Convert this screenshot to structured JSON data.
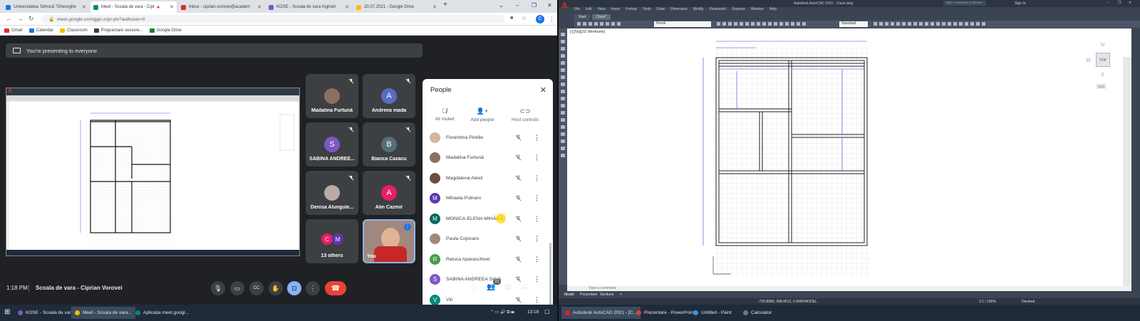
{
  "browser": {
    "tabs": [
      {
        "title": "Universitatea Tehnică \"Gheorghe",
        "fav": "#1a73e8"
      },
      {
        "title": "Meet - Scoala de vara - Cipr",
        "fav": "#00897b"
      },
      {
        "title": "Inbox - ciprian.vorovei@academ",
        "fav": "#d93025"
      },
      {
        "title": "KOSE - Scoala de vara Ingineri",
        "fav": "#7e57c2"
      },
      {
        "title": "20.07.2021 - Google Drive",
        "fav": "#fbbc04"
      }
    ],
    "url": "meet.google.com/ggo-zojn-ytv?authuser=0",
    "profile_initial": "C",
    "bookmarks": [
      {
        "label": "Gmail",
        "color": "#d93025"
      },
      {
        "label": "Calendar",
        "color": "#1a73e8"
      },
      {
        "label": "Classroom",
        "color": "#fbbc04"
      },
      {
        "label": "Programare sesiune...",
        "color": "#3c4043"
      },
      {
        "label": "Google Drive",
        "color": "#188038"
      }
    ]
  },
  "meet": {
    "presenting_banner": "You're presenting to everyone",
    "tiles": [
      {
        "name": "Madalina Furtună",
        "initial": "",
        "color": "#8d6e63",
        "photo": true
      },
      {
        "name": "Andreea mada",
        "initial": "A",
        "color": "#5c6bc0"
      },
      {
        "name": "SABINA ANDREE...",
        "initial": "S",
        "color": "#7e57c2"
      },
      {
        "name": "Bianca Cazacu",
        "initial": "B",
        "color": "#546e7a"
      },
      {
        "name": "Denisa Alungule...",
        "initial": "",
        "color": "#bcaaa4",
        "photo": true
      },
      {
        "name": "Alin Cazmir",
        "initial": "A",
        "color": "#e91e63"
      },
      {
        "name": "13 others",
        "initial": "C",
        "initial2": "M",
        "color": "#e91e63",
        "color2": "#5e35b1"
      },
      {
        "name": "You",
        "initial": "",
        "color": "#c62828",
        "photo": true
      }
    ],
    "people_panel": {
      "title": "People",
      "actions": [
        {
          "label": "All muted",
          "icon": "mic-off-icon"
        },
        {
          "label": "Add people",
          "icon": "add-person-icon"
        },
        {
          "label": "Host controls",
          "icon": "host-controls-icon"
        }
      ],
      "participants": [
        {
          "name": "Florentina Pintilie",
          "initial": "",
          "color": "#d7b49e"
        },
        {
          "name": "Madalina Furtună",
          "initial": "",
          "color": "#8d6e63"
        },
        {
          "name": "Magdalena Alexii",
          "initial": "",
          "color": "#6d4c41"
        },
        {
          "name": "Mihaela Putnaru",
          "initial": "M",
          "color": "#5e35b1"
        },
        {
          "name": "MONICA-ELENA MIHĂILĂ",
          "initial": "M",
          "color": "#00695c"
        },
        {
          "name": "Paula Cojocaru",
          "initial": "",
          "color": "#a1887f"
        },
        {
          "name": "Raluca Aparaschivei",
          "initial": "R",
          "color": "#43a047"
        },
        {
          "name": "SABINA ANDREEA SAVA",
          "initial": "S",
          "color": "#7e57c2"
        },
        {
          "name": "Vlii",
          "initial": "V",
          "color": "#00897b"
        }
      ]
    },
    "bottom": {
      "time": "1:18 PM",
      "meeting_name": "Scoala de vara - Ciprian Vorovei",
      "participant_count": "21"
    }
  },
  "taskbar_left": {
    "items": [
      "KOSE - Scoala de vara",
      "Meet - Scoala de vara...",
      "Aplicația meet.googl..."
    ],
    "clock": "13:18"
  },
  "autocad": {
    "title": "Autodesk AutoCAD 2021 - Clase.dwg",
    "search_placeholder": "Type a keyword or phrase",
    "sign_in": "Sign In",
    "menu": [
      "File",
      "Edit",
      "View",
      "Insert",
      "Format",
      "Tools",
      "Draw",
      "Dimension",
      "Modify",
      "Parametric",
      "Express",
      "Window",
      "Help"
    ],
    "file_tabs": [
      "Start",
      "Clase*"
    ],
    "layer": "Pereti",
    "style": "Standard",
    "viewport_label": "[-][Top][2D Wireframe]",
    "viewcube": {
      "top": "TOP",
      "n": "N",
      "w": "W",
      "s": "S",
      "wcs": "WCS"
    },
    "command_placeholder": "Type a command",
    "layout_tabs": [
      "Model",
      "Prezentare",
      "Sectiune"
    ],
    "coords": "-720.8980, 268.4512, 0.0000",
    "mode": "MODEL",
    "scale": "1:1 / 100%",
    "units": "Decimal"
  },
  "taskbar_right": {
    "items": [
      "Autodesk AutoCAD 2021 - [C...",
      "Prezentare - PowerPoint",
      "Untitled - Paint",
      "Calculator"
    ]
  }
}
